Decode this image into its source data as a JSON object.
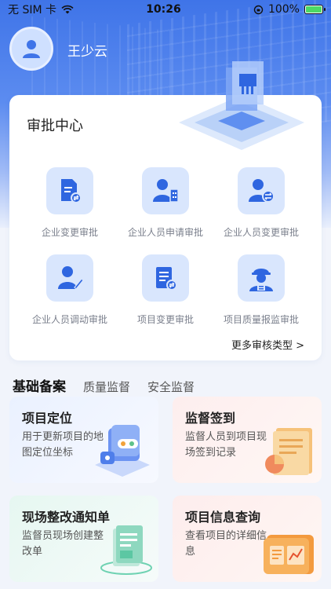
{
  "status_bar": {
    "carrier": "无 SIM 卡",
    "time": "10:26",
    "battery": "100%"
  },
  "profile": {
    "name": "王少云"
  },
  "approval": {
    "title": "审批中心",
    "items": [
      {
        "label": "企业变更审批",
        "icon": "company-change-icon"
      },
      {
        "label": "企业人员申请审批",
        "icon": "staff-apply-icon"
      },
      {
        "label": "企业人员变更审批",
        "icon": "staff-change-icon"
      },
      {
        "label": "企业人员调动审批",
        "icon": "staff-transfer-icon"
      },
      {
        "label": "项目变更审批",
        "icon": "project-change-icon"
      },
      {
        "label": "项目质量报监审批",
        "icon": "quality-inspector-icon"
      }
    ],
    "more": "更多审核类型 >"
  },
  "tabs": [
    "基础备案",
    "质量监督",
    "安全监督"
  ],
  "features": [
    {
      "title": "项目定位",
      "desc": "用于更新项目的地图定位坐标"
    },
    {
      "title": "监督签到",
      "desc": "监督人员到项目现场签到记录"
    },
    {
      "title": "现场整改通知单",
      "desc": "监督员现场创建整改单"
    },
    {
      "title": "项目信息查询",
      "desc": "查看项目的详细信息"
    }
  ],
  "colors": {
    "primary": "#3f74e8",
    "tile": "#d9e6fd",
    "icon": "#2f66e0"
  }
}
